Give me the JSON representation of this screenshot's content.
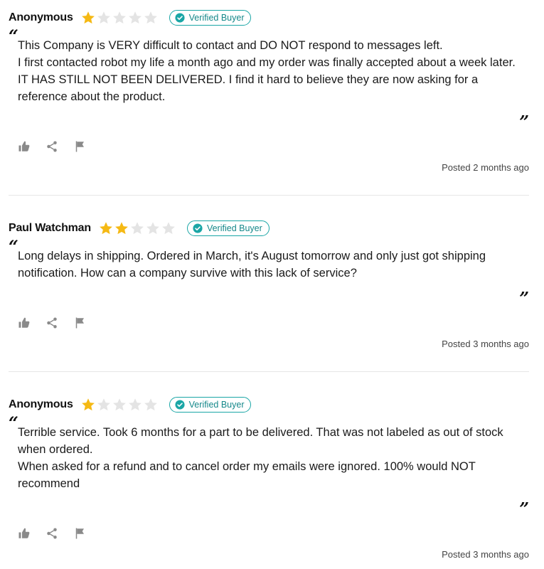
{
  "colors": {
    "star_filled": "#f5b914",
    "star_empty": "#e4e4e4",
    "badge": "#1aa6a6",
    "icon_gray": "#8a8a8a"
  },
  "icons": [
    "star-icon",
    "check-circle-icon",
    "thumbs-up-icon",
    "share-icon",
    "flag-icon"
  ],
  "reviews": [
    {
      "name": "Anonymous",
      "rating": 1,
      "max_rating": 5,
      "badge": "Verified Buyer",
      "paragraphs": [
        "This Company is VERY difficult to contact and DO NOT respond to messages left.",
        "I first contacted robot my life a month ago and my order was finally accepted about a week later. IT HAS STILL NOT BEEN DELIVERED. I find it hard to believe they are now asking for a reference about the product."
      ],
      "posted": "Posted 2 months ago"
    },
    {
      "name": "Paul Watchman",
      "rating": 2,
      "max_rating": 5,
      "badge": "Verified Buyer",
      "paragraphs": [
        "Long delays in shipping.  Ordered in March,  it's August tomorrow and only just got shipping notification.  How can a company survive with this lack of service?"
      ],
      "posted": "Posted 3 months ago"
    },
    {
      "name": "Anonymous",
      "rating": 1,
      "max_rating": 5,
      "badge": "Verified Buyer",
      "paragraphs": [
        "Terrible service. Took 6 months for a part to be delivered. That was not labeled as out of stock when ordered.",
        "When asked for a refund and to cancel order my emails were ignored. 100% would NOT recommend"
      ],
      "posted": "Posted 3 months ago"
    }
  ]
}
